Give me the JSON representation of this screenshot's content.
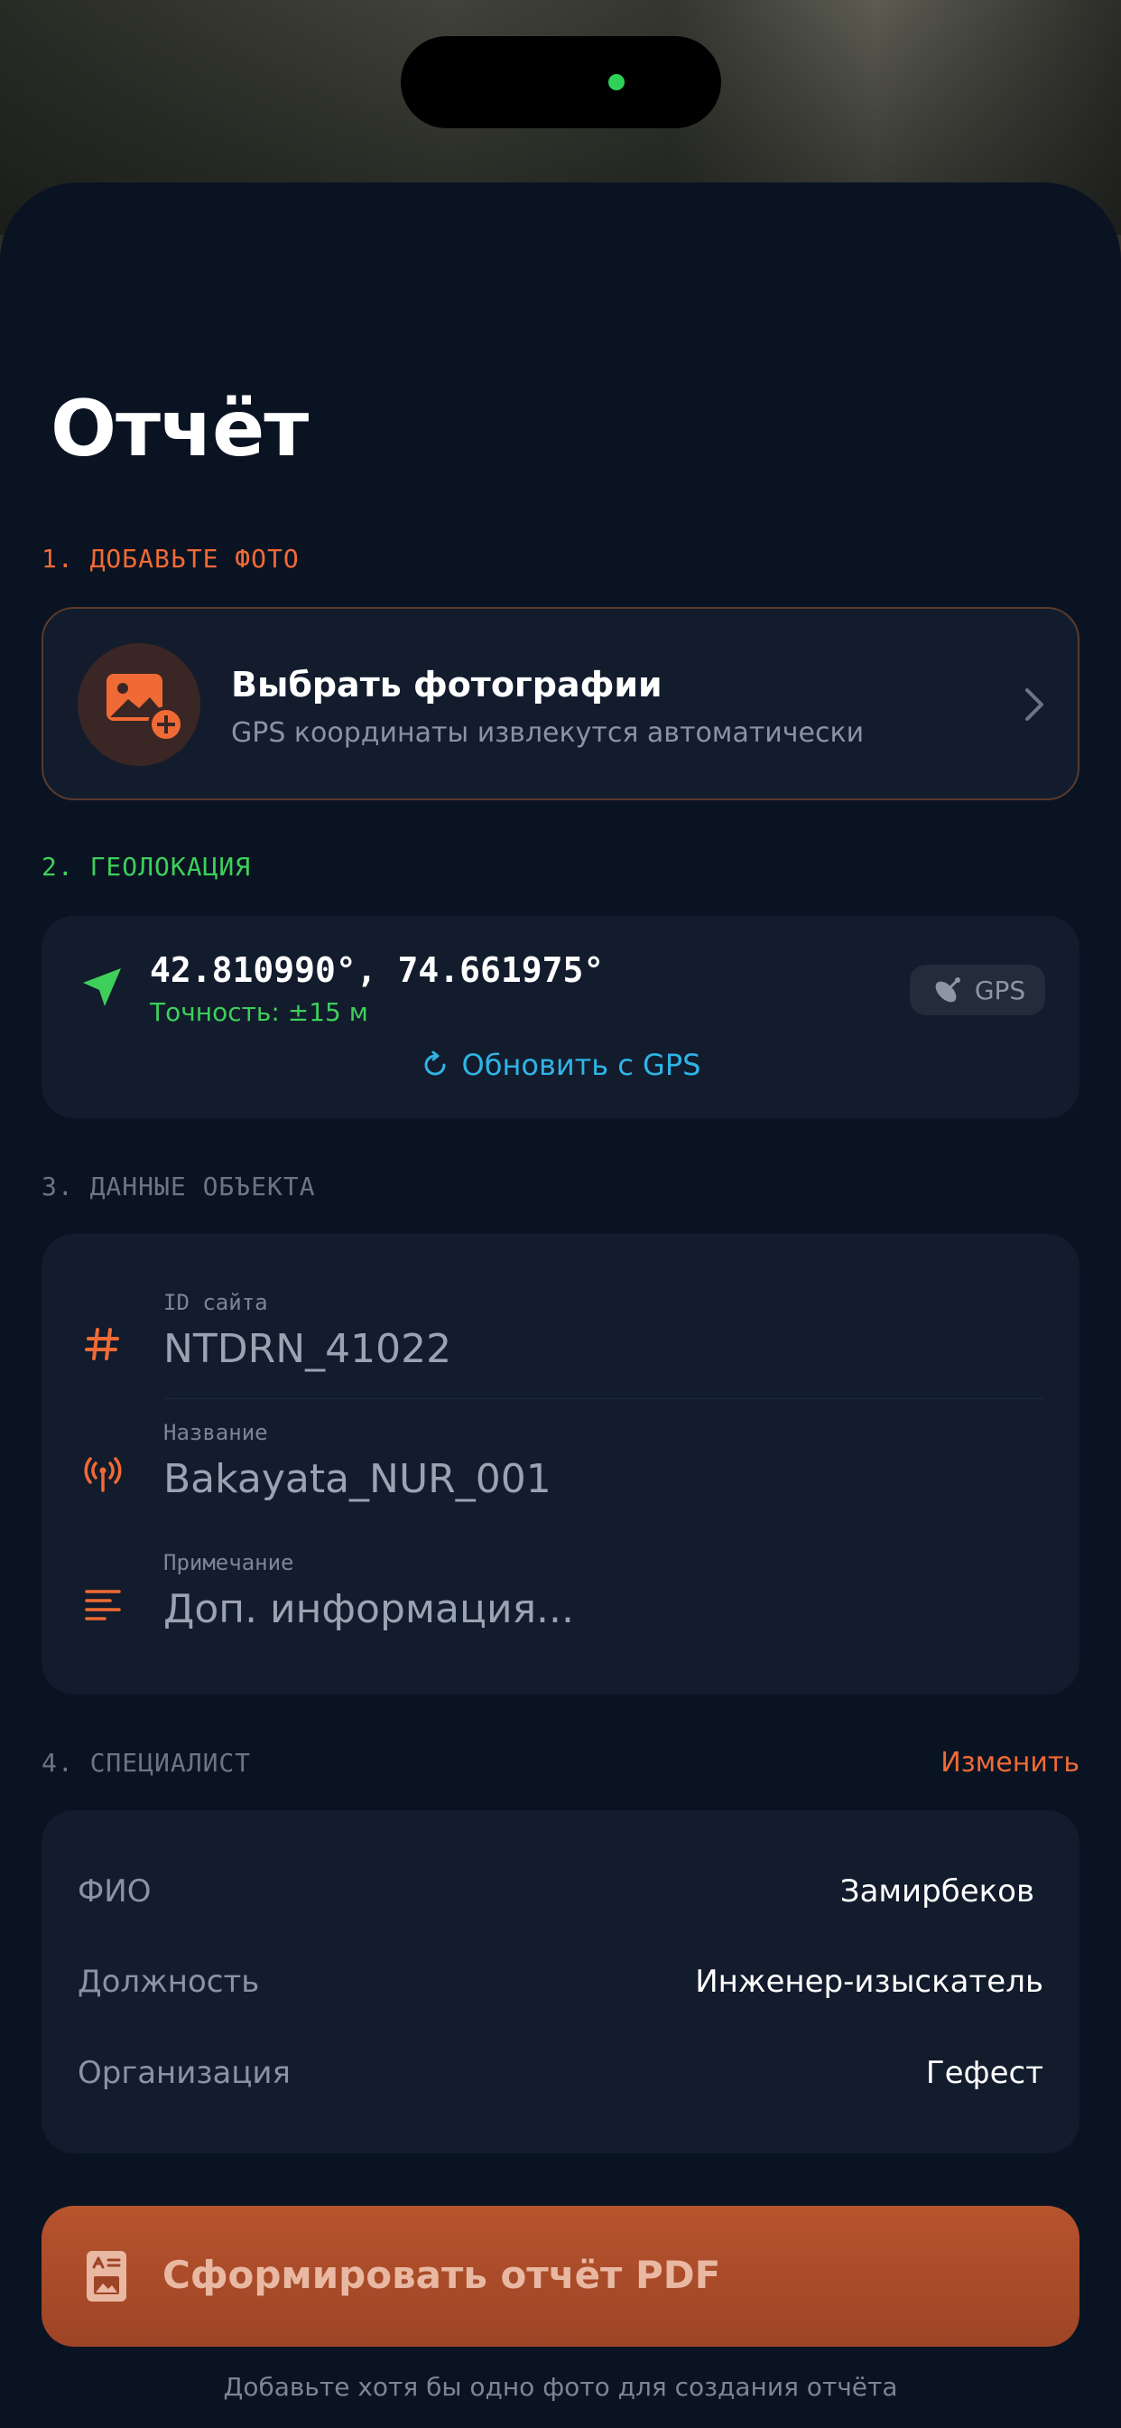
{
  "title": "Отчёт",
  "sections": {
    "photo": {
      "label": "1. ДОБАВЬТЕ ФОТО",
      "color": "#f06a35"
    },
    "geo": {
      "label": "2. ГЕОЛОКАЦИЯ",
      "color": "#3ecf5a"
    },
    "object": {
      "label": "3. ДАННЫЕ ОБЪЕКТА",
      "color": "#6b7585"
    },
    "specialist": {
      "label": "4. СПЕЦИАЛИСТ",
      "color": "#6b7585"
    }
  },
  "photo_card": {
    "title": "Выбрать фотографии",
    "subtitle": "GPS координаты извлекутся автоматически",
    "icon": "photo-add-icon"
  },
  "geo_card": {
    "coords": "42.810990°, 74.661975°",
    "accuracy": "Точность: ±15 м",
    "badge": "GPS",
    "refresh_label": "Обновить с GPS"
  },
  "object_card": {
    "fields": [
      {
        "label": "ID сайта",
        "value": "NTDRN_41022",
        "icon": "hash-icon"
      },
      {
        "label": "Название",
        "value": "Bakayata_NUR_001",
        "icon": "antenna-icon"
      },
      {
        "label": "Примечание",
        "placeholder": "Доп. информация...",
        "icon": "notes-icon"
      }
    ]
  },
  "specialist_card": {
    "change_label": "Изменить",
    "rows": [
      {
        "key": "ФИО",
        "value": "Замирбеков"
      },
      {
        "key": "Должность",
        "value": "Инженер-изыскатель"
      },
      {
        "key": "Организация",
        "value": "Гефест"
      }
    ]
  },
  "generate_button": {
    "label": "Сформировать отчёт PDF"
  },
  "hint": "Добавьте хотя бы одно фото для создания отчёта",
  "colors": {
    "accent": "#f06a35",
    "green": "#3ecf5a",
    "link": "#2fb4e6",
    "background": "#0a1322",
    "card": "#121c2d"
  }
}
